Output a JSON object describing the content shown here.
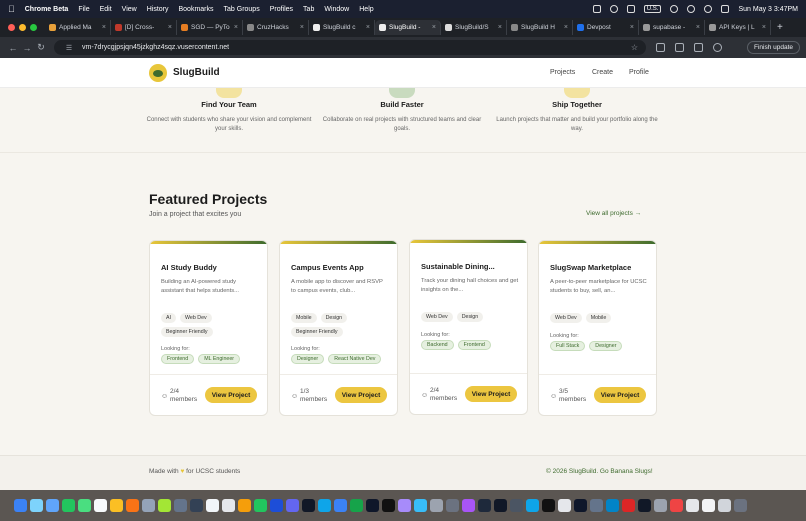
{
  "menubar": {
    "app": "Chrome Beta",
    "items": [
      "File",
      "Edit",
      "View",
      "History",
      "Bookmarks",
      "Tab Groups",
      "Profiles",
      "Tab",
      "Window",
      "Help"
    ],
    "input_source": "U.S.",
    "clock": "Sun May 3  3:47PM"
  },
  "tabs": [
    {
      "title": "Applied Ma",
      "active": false
    },
    {
      "title": "[D] Cross-",
      "active": false
    },
    {
      "title": "SGD — PyTo",
      "active": false
    },
    {
      "title": "CruzHacks",
      "active": false
    },
    {
      "title": "SlugBuild c",
      "active": false
    },
    {
      "title": "SlugBuild -",
      "active": true
    },
    {
      "title": "SlugBuild/S",
      "active": false
    },
    {
      "title": "SlugBuild H",
      "active": false
    },
    {
      "title": "Devpost",
      "active": false
    },
    {
      "title": "supabase -",
      "active": false
    },
    {
      "title": "API Keys | L",
      "active": false
    }
  ],
  "address": {
    "url": "vm-7drycgjpsjqn45jzkghz4sqz.vusercontent.net",
    "finish_update": "Finish update"
  },
  "site": {
    "brand": "SlugBuild",
    "nav": [
      "Projects",
      "Create",
      "Profile"
    ]
  },
  "features": [
    {
      "title": "Find Your Team",
      "desc": "Connect with students who share your vision and complement your skills.",
      "color": "#e8c63a"
    },
    {
      "title": "Build Faster",
      "desc": "Collaborate on real projects with structured teams and clear goals.",
      "color": "#5b8a4a"
    },
    {
      "title": "Ship Together",
      "desc": "Launch projects that matter and build your portfolio along the way.",
      "color": "#e8c63a"
    }
  ],
  "featured": {
    "title": "Featured Projects",
    "subtitle": "Join a project that excites you",
    "view_all": "View all projects"
  },
  "projects": [
    {
      "title": "AI Study Buddy",
      "desc": "Building an AI-powered study assistant that helps students...",
      "tags": [
        "AI",
        "Web Dev",
        "Beginner Friendly"
      ],
      "looking_for_label": "Looking for:",
      "needs": [
        "Frontend",
        "ML Engineer"
      ],
      "members": "2/4",
      "members_label": "members",
      "button": "View Project"
    },
    {
      "title": "Campus Events App",
      "desc": "A mobile app to discover and RSVP to campus events, club...",
      "tags": [
        "Mobile",
        "Design",
        "Beginner Friendly"
      ],
      "looking_for_label": "Looking for:",
      "needs": [
        "Designer",
        "React Native Dev"
      ],
      "members": "1/3",
      "members_label": "members",
      "button": "View Project"
    },
    {
      "title": "Sustainable Dining...",
      "desc": "Track your dining hall choices and get insights on the...",
      "tags": [
        "Web Dev",
        "Design"
      ],
      "looking_for_label": "Looking for:",
      "needs": [
        "Backend",
        "Frontend"
      ],
      "members": "2/4",
      "members_label": "members",
      "button": "View Project"
    },
    {
      "title": "SlugSwap Marketplace",
      "desc": "A peer-to-peer marketplace for UCSC students to buy, sell, an...",
      "tags": [
        "Web Dev",
        "Mobile"
      ],
      "looking_for_label": "Looking for:",
      "needs": [
        "Full Stack",
        "Designer"
      ],
      "members": "3/5",
      "members_label": "members",
      "button": "View Project"
    }
  ],
  "footer": {
    "left_prefix": "Made with",
    "left_suffix": "for UCSC students",
    "right": "© 2026 SlugBuild. Go Banana Slugs!"
  },
  "colors": {
    "accent_yellow": "#ecc640",
    "accent_green": "#3e6b2e",
    "page_bg": "#f7f5f0"
  }
}
